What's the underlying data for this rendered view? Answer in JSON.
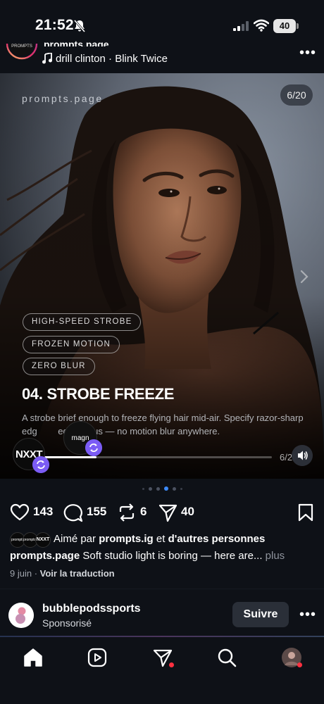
{
  "status_bar": {
    "time": "21:52",
    "battery": "40",
    "icons": [
      "bell-off-icon",
      "signal-icon",
      "wifi-icon",
      "battery-icon"
    ]
  },
  "post": {
    "header": {
      "account_cut": "prompts.page",
      "music": "drill clinton · Blink Twice"
    },
    "media": {
      "watermark": "prompts.page",
      "slide_counter": "6/20",
      "tags": [
        "HIGH-SPEED STROBE",
        "FROZEN MOTION",
        "ZERO BLUR"
      ],
      "title": "04. STROBE FREEZE",
      "description": "A strobe brief enough to freeze flying hair mid-air. Specify razor-sharp edg   edge focus — no motion blur anywhere.",
      "progress_label": "6/20",
      "progress_fraction": 0.23,
      "collab_left": "NXXT",
      "collab_right": "magn"
    },
    "carousel": {
      "dot_count": 6,
      "active_index": 3
    },
    "actions": {
      "likes": "143",
      "comments": "155",
      "reposts": "6",
      "shares": "40"
    },
    "liked_by": {
      "prefix": "Aimé par ",
      "user": "prompts.ig",
      "middle": " et ",
      "suffix": "d'autres personnes",
      "avatars": [
        "prompts",
        "prompts.ai",
        "NXXT"
      ]
    },
    "caption": {
      "user": "prompts.page",
      "text": " Soft studio light is boring — here are...",
      "more": " plus"
    },
    "date": "9 juin",
    "separator": " · ",
    "translate": "Voir la traduction"
  },
  "sponsored": {
    "name": "bubblepodssports",
    "label": "Sponsorisé",
    "follow": "Suivre"
  },
  "colors": {
    "background": "#0e1117",
    "accent_blue": "#3d8bfd",
    "remix_purple": "#7b5cf5",
    "notification_red": "#ff3040"
  }
}
